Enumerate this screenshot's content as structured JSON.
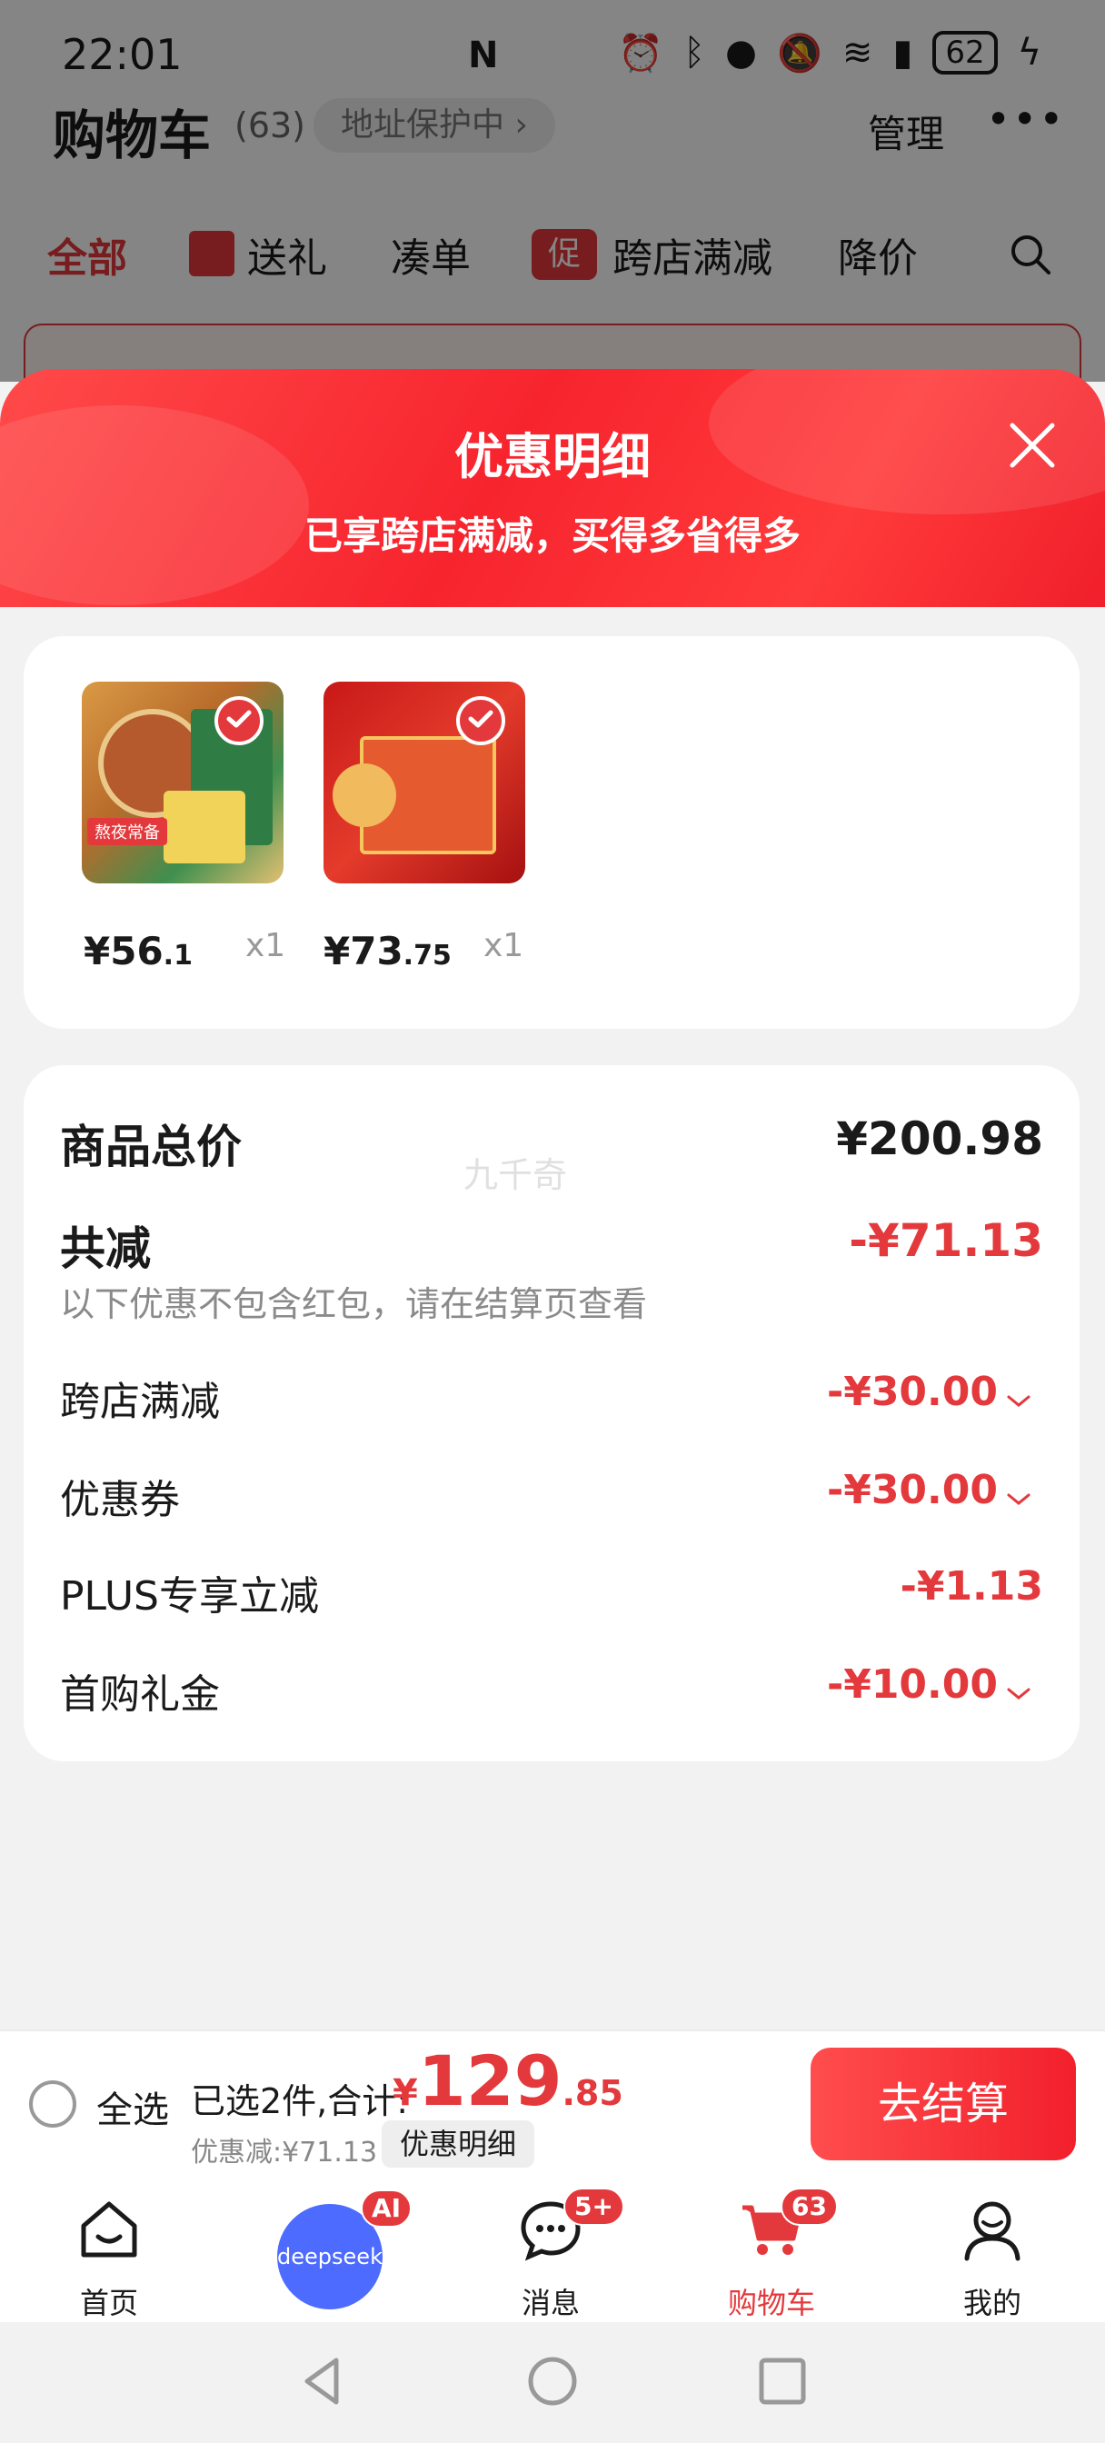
{
  "status_bar": {
    "time": "22:01",
    "battery": "62"
  },
  "cart_header": {
    "title": "购物车",
    "count": "(63)",
    "address": "地址保护中",
    "manage": "管理"
  },
  "filter_tabs": [
    "全部",
    "送礼",
    "凑单",
    "跨店满减",
    "降价"
  ],
  "promo_icon_text": "促",
  "sheet": {
    "title": "优惠明细",
    "subtitle": "已享跨店满减，买得多省得多"
  },
  "products": [
    {
      "price_int": "¥56",
      "price_dec": ".1",
      "qty": "x1",
      "tag": "熬夜常备"
    },
    {
      "price_int": "¥73",
      "price_dec": ".75",
      "qty": "x1"
    }
  ],
  "summary": {
    "total_label": "商品总价",
    "total_value": "¥200.98",
    "reduced_label": "共减",
    "reduced_value": "-¥71.13",
    "note": "以下优惠不包含红包，请在结算页查看",
    "watermark": "九千奇",
    "rows": [
      {
        "label": "跨店满减",
        "value": "-¥30.00",
        "expandable": true
      },
      {
        "label": "优惠券",
        "value": "-¥30.00",
        "expandable": true
      },
      {
        "label": "PLUS专享立减",
        "value": "-¥1.13",
        "expandable": false
      },
      {
        "label": "首购礼金",
        "value": "-¥10.00",
        "expandable": true
      }
    ]
  },
  "checkout": {
    "select_all": "全选",
    "selected_info": "已选2件,合计:",
    "total_yen": "¥",
    "total_int": "129",
    "total_dec": ".85",
    "discount_line": "优惠减:¥71.13",
    "detail_button": "优惠明细",
    "checkout_button": "去结算"
  },
  "bottom_nav": [
    {
      "label": "首页",
      "icon": "home-icon"
    },
    {
      "label": "",
      "icon": "deepseek-icon",
      "badge": "AI",
      "brand_text": "deepseek"
    },
    {
      "label": "消息",
      "icon": "message-icon",
      "badge": "5+"
    },
    {
      "label": "购物车",
      "icon": "cart-icon",
      "badge": "63",
      "active": true
    },
    {
      "label": "我的",
      "icon": "profile-icon"
    }
  ],
  "colors": {
    "accent": "#e4393c",
    "deepseek": "#4d6bfe"
  }
}
